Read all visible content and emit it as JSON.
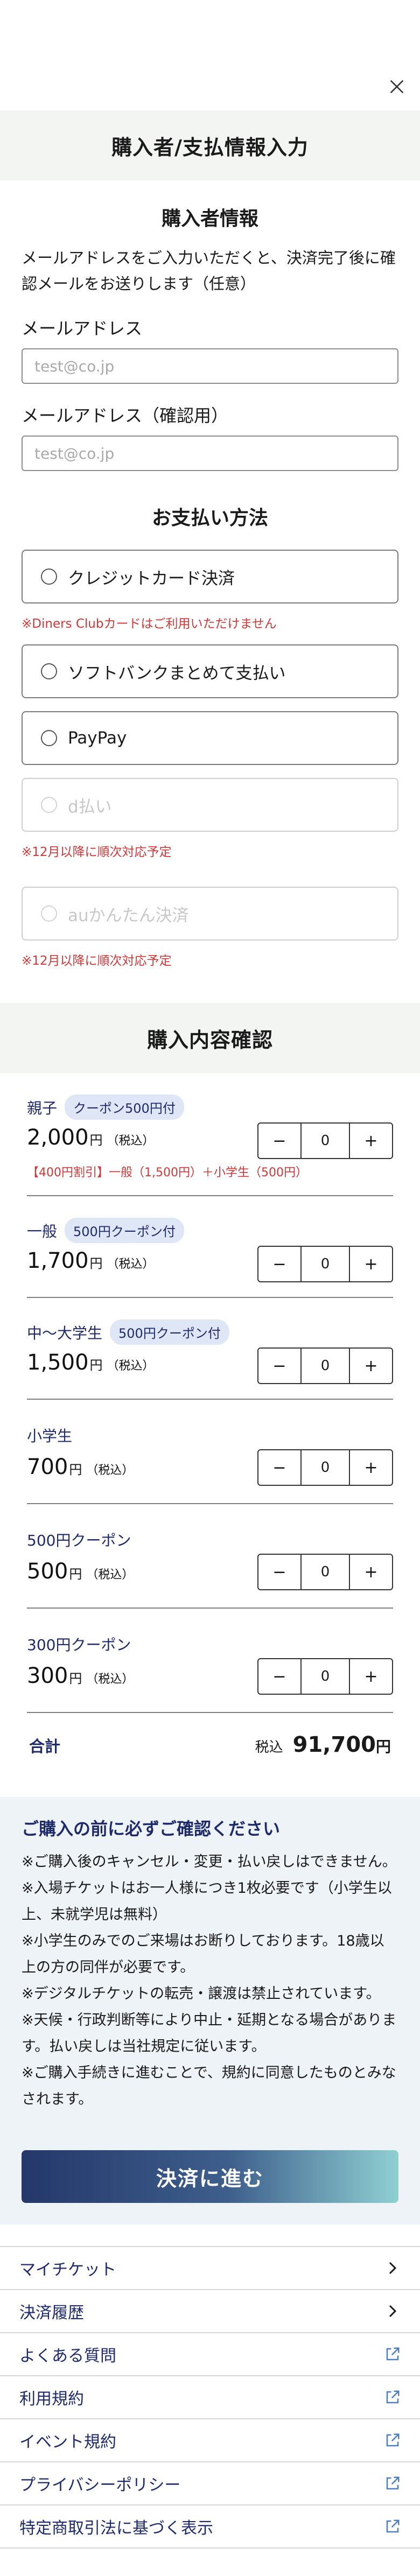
{
  "header": {
    "title": "購入者/支払情報入力"
  },
  "buyer": {
    "title": "購入者情報",
    "note": "メールアドレスをご入力いただくと、決済完了後に確認メールをお送りします（任意）",
    "email_label": "メールアドレス",
    "email_placeholder": "test@co.jp",
    "email_confirm_label": "メールアドレス（確認用）",
    "email_confirm_placeholder": "test@co.jp"
  },
  "payment": {
    "title": "お支払い方法",
    "options": [
      {
        "label": "クレジットカード決済",
        "note": "※Diners Clubカードはご利用いただけません"
      },
      {
        "label": "ソフトバンクまとめて支払い"
      },
      {
        "label": "PayPay"
      },
      {
        "label": "d払い",
        "note": "※12月以降に順次対応予定"
      },
      {
        "label": "auかんたん決済",
        "note": "※12月以降に順次対応予定"
      }
    ]
  },
  "confirm": {
    "title": "購入内容確認",
    "currency_unit": "円",
    "tax_label": "（税込）",
    "items": [
      {
        "name": "親子",
        "badge": "クーポン500円付",
        "price": "2,000",
        "qty": "0",
        "discount": "【400円割引】一般（1,500円）＋小学生（500円）"
      },
      {
        "name": "一般",
        "badge": "500円クーポン付",
        "price": "1,700",
        "qty": "0"
      },
      {
        "name": "中〜大学生",
        "badge": "500円クーポン付",
        "price": "1,500",
        "qty": "0"
      },
      {
        "name": "小学生",
        "price": "700",
        "qty": "0"
      },
      {
        "name": "500円クーポン",
        "price": "500",
        "qty": "0"
      },
      {
        "name": "300円クーポン",
        "price": "300",
        "qty": "0"
      }
    ],
    "minus": "−",
    "plus": "+",
    "total_label": "合計",
    "total_tax": "税込",
    "total_value": "91,700",
    "total_unit": "円"
  },
  "caution": {
    "title": "ご購入の前に必ずご確認ください",
    "items": [
      "※ご購入後のキャンセル・変更・払い戻しはできません。",
      "※入場チケットはお一人様につき1枚必要です（小学生以上、未就学児は無料）",
      "※小学生のみでのご来場はお断りしております。18歳以上の方の同伴が必要です。",
      "※デジタルチケットの転売・譲渡は禁止されています。",
      "※天候・行政判断等により中止・延期となる場合があります。払い戻しは当社規定に従います。",
      "※ご購入手続きに進むことで、規約に同意したものとみなされます。"
    ]
  },
  "pay_button": "決済に進む",
  "footer": {
    "links": [
      {
        "label": "マイチケット",
        "icon": "chevron-right-icon"
      },
      {
        "label": "決済履歴",
        "icon": "chevron-right-icon"
      },
      {
        "label": "よくある質問",
        "icon": "external-link-icon"
      },
      {
        "label": "利用規約",
        "icon": "external-link-icon"
      },
      {
        "label": "イベント規約",
        "icon": "external-link-icon"
      },
      {
        "label": "プライバシーポリシー",
        "icon": "external-link-icon"
      },
      {
        "label": "特定商取引法に基づく表示",
        "icon": "external-link-icon"
      }
    ]
  },
  "colors": {
    "navy": "#1f2a6b",
    "notice_red": "#d03838",
    "band_bg": "#f3f5f3",
    "caution_bg": "#eef3f7"
  }
}
